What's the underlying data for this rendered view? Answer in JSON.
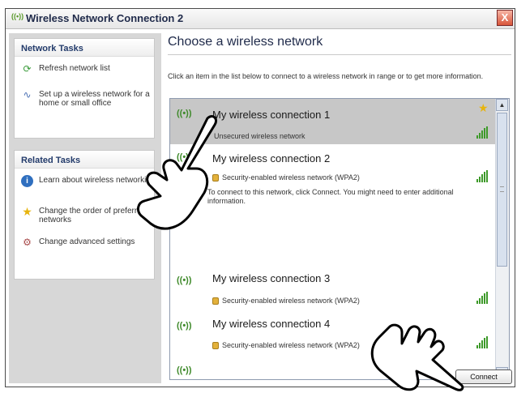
{
  "window": {
    "title": "Wireless Network Connection 2",
    "icon": "wireless-icon",
    "close_label": "X"
  },
  "sidebar": {
    "network_tasks": {
      "header": "Network Tasks",
      "items": [
        {
          "label": "Refresh network list",
          "icon": "refresh-icon"
        },
        {
          "label": "Set up a wireless network for a home or small office",
          "icon": "setup-icon"
        }
      ]
    },
    "related_tasks": {
      "header": "Related Tasks",
      "items": [
        {
          "label": "Learn about wireless networking",
          "icon": "info-icon"
        },
        {
          "label": "Change the order of preferred networks",
          "icon": "star-icon"
        },
        {
          "label": "Change advanced settings",
          "icon": "settings-icon"
        }
      ]
    }
  },
  "main": {
    "heading": "Choose a wireless network",
    "instructions": "Click an item in the list below to connect to a wireless network in range or to get more information.",
    "networks": [
      {
        "name": "My wireless connection 1",
        "status": "Unsecured wireless network",
        "selected": true,
        "favorite": true
      },
      {
        "name": "My wireless connection 2",
        "status": "Security-enabled wireless network (WPA2)",
        "description": "To connect to this network, click Connect. You might need to enter additional information."
      },
      {
        "name": "My wireless connection 3",
        "status": "Security-enabled wireless network (WPA2)"
      },
      {
        "name": "My wireless connection 4",
        "status": "Security-enabled wireless network (WPA2)"
      }
    ],
    "antenna_glyph": "((•))",
    "connect_label": "Connect"
  },
  "colors": {
    "accent": "#3e9a2a",
    "selected_row": "#c7c7c7",
    "heading": "#1f2a4a"
  }
}
